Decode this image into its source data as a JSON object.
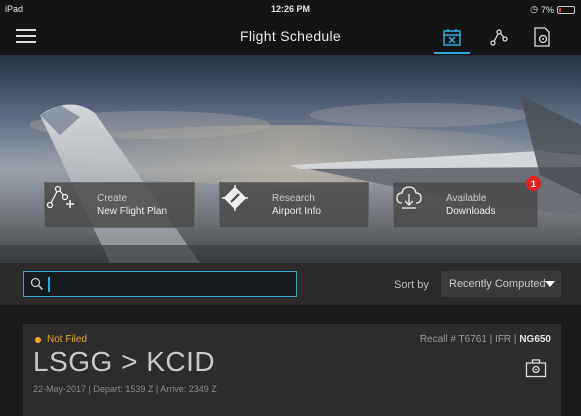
{
  "status_bar": {
    "device": "iPad",
    "time": "12:26 PM",
    "battery": "7%"
  },
  "nav": {
    "title": "Flight Schedule"
  },
  "tiles": [
    {
      "line1": "Create",
      "line2": "New Flight Plan",
      "icon": "route-plus-icon"
    },
    {
      "line1": "Research",
      "line2": "Airport Info",
      "icon": "compass-icon"
    },
    {
      "line1": "Available",
      "line2": "Downloads",
      "icon": "cloud-download-icon",
      "badge": "1"
    }
  ],
  "search": {
    "value": "",
    "placeholder": ""
  },
  "sort": {
    "label": "Sort by",
    "selected": "Recently Computed"
  },
  "flights": [
    {
      "status": "Not Filed",
      "recall_prefix": "Recall # T6761 | IFR | ",
      "aircraft": "NG650",
      "route": "LSGG > KCID",
      "details": "22-May-2017 | Depart: 1539 Z | Arrive: 2349 Z"
    }
  ],
  "colors": {
    "accent": "#2fa8e0",
    "status_not_filed": "#f3a51f",
    "badge": "#e81e25"
  }
}
